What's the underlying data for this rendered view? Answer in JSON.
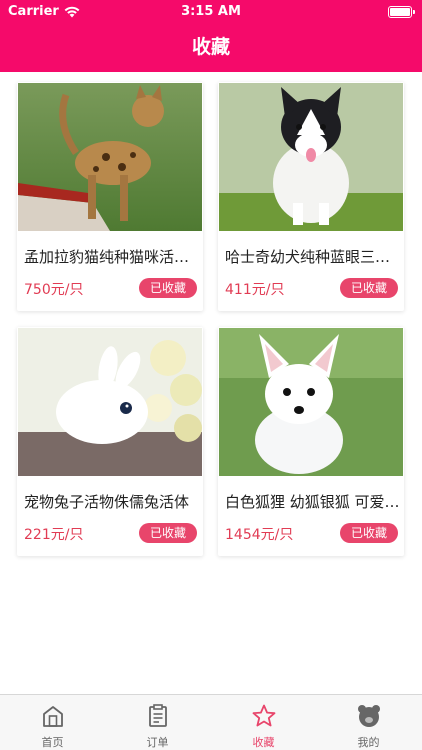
{
  "status_bar": {
    "carrier": "Carrier",
    "time": "3:15 AM"
  },
  "nav": {
    "title": "收藏"
  },
  "products": [
    {
      "title": "孟加拉豹猫纯种猫咪活体宠物猫",
      "price": "750元/只",
      "fav_label": "已收藏",
      "image": "bengal-cat"
    },
    {
      "title": "哈士奇幼犬纯种蓝眼三把火",
      "price": "411元/只",
      "fav_label": "已收藏",
      "image": "husky-puppy"
    },
    {
      "title": "宠物兔子活物侏儒兔活体",
      "price": "221元/只",
      "fav_label": "已收藏",
      "image": "white-rabbit"
    },
    {
      "title": "白色狐狸 幼狐银狐 可爱宠物",
      "price": "1454元/只",
      "fav_label": "已收藏",
      "image": "white-fox-pup"
    }
  ],
  "tabs": [
    {
      "label": "首页",
      "icon": "home-icon",
      "active": false
    },
    {
      "label": "订单",
      "icon": "order-icon",
      "active": false
    },
    {
      "label": "收藏",
      "icon": "star-icon",
      "active": true
    },
    {
      "label": "我的",
      "icon": "bear-icon",
      "active": false
    }
  ],
  "colors": {
    "brand": "#f50a6a",
    "accent": "#e8456b",
    "price": "#e13c54",
    "tab_inactive": "#666666"
  }
}
